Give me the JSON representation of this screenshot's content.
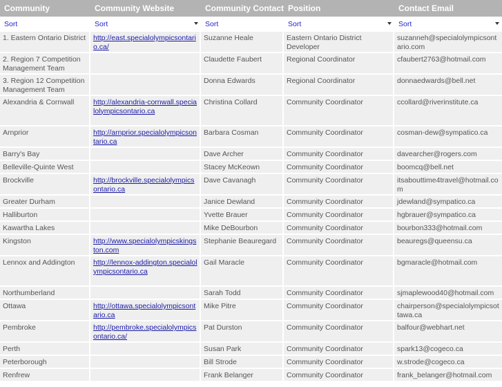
{
  "columns": [
    {
      "label": "Community",
      "sort_label": "Sort",
      "has_dropdown": false
    },
    {
      "label": "Community Website",
      "sort_label": "Sort",
      "has_dropdown": true
    },
    {
      "label": "Community Contact",
      "sort_label": "Sort",
      "has_dropdown": false
    },
    {
      "label": "Position",
      "sort_label": "Sort",
      "has_dropdown": true
    },
    {
      "label": "Contact Email",
      "sort_label": "Sort",
      "has_dropdown": true
    }
  ],
  "rows": [
    {
      "community": "1. Eastern Ontario District",
      "website": "http://east.specialolympicsontario.ca/",
      "contact": "Suzanne Heale",
      "position": "Eastern Ontario District Developer",
      "email": "suzanneh@specialolympicsontario.com"
    },
    {
      "community": "2. Region 7 Competition Management Team",
      "website": "",
      "contact": "Claudette Faubert",
      "position": "Regional Coordinator",
      "email": "cfaubert2763@hotmail.com"
    },
    {
      "community": "3. Region 12 Competition Management Team",
      "website": "",
      "contact": "Donna Edwards",
      "position": "Regional Coordinator",
      "email": "donnaedwards@bell.net"
    },
    {
      "community": "Alexandria & Cornwall",
      "website": "http://alexandria-cornwall.specialolympicsontario.ca",
      "contact": "Christina Collard",
      "position": "Community Coordinator",
      "email": "ccollard@riverinstitute.ca"
    },
    {
      "community": "Arnprior",
      "website": "http://arnprior.specialolympicsontario.ca",
      "contact": "Barbara Cosman",
      "position": "Community Coordinator",
      "email": "cosman-dew@sympatico.ca"
    },
    {
      "community": "Barry's Bay",
      "website": "",
      "contact": "Dave Archer",
      "position": "Community Coordinator",
      "email": "davearcher@rogers.com"
    },
    {
      "community": "Belleville-Quinte West",
      "website": "",
      "contact": "Stacey McKeown",
      "position": "Community Coordinator",
      "email": "boomcq@bell.net"
    },
    {
      "community": "Brockville",
      "website": "http://brockville.specialolympicsontario.ca",
      "contact": "Dave Cavanagh",
      "position": "Community Coordinator",
      "email": "itsabouttime4travel@hotmail.com"
    },
    {
      "community": "Greater Durham",
      "website": "",
      "contact": "Janice Dewland",
      "position": "Community Coordinator",
      "email": "jdewland@sympatico.ca"
    },
    {
      "community": "Halliburton",
      "website": "",
      "contact": "Yvette Brauer",
      "position": "Community Coordinator",
      "email": "hgbrauer@sympatico.ca"
    },
    {
      "community": "Kawartha Lakes",
      "website": "",
      "contact": "Mike DeBourbon",
      "position": "Community Coordinator",
      "email": "bourbon333@hotmail.com"
    },
    {
      "community": "Kingston",
      "website": "http://www.specialolympicskingston.com",
      "contact": "Stephanie Beauregard",
      "position": "Community Coordinator",
      "email": "beauregs@queensu.ca"
    },
    {
      "community": "Lennox and Addington",
      "website": "http://lennox-addington.specialolympicsontario.ca",
      "contact": "Gail Maracle",
      "position": "Community Coordinator",
      "email": "bgmaracle@hotmail.com"
    },
    {
      "community": "Northumberland",
      "website": "",
      "contact": "Sarah Todd",
      "position": "Community Coordinator",
      "email": "sjmaplewood40@hotmail.com"
    },
    {
      "community": "Ottawa",
      "website": "http://ottawa.specialolympicsontario.ca",
      "contact": "Mike Pitre",
      "position": "Community Coordinator",
      "email": "chairperson@specialolympicsottawa.ca"
    },
    {
      "community": "Pembroke",
      "website": "http://pembroke.specialolympicsontario.ca/",
      "contact": "Pat Durston",
      "position": "Community Coordinator",
      "email": "balfour@webhart.net"
    },
    {
      "community": "Perth",
      "website": "",
      "contact": "Susan Park",
      "position": "Community Coordinator",
      "email": "spark13@cogeco.ca"
    },
    {
      "community": "Peterborough",
      "website": "",
      "contact": "Bill Strode",
      "position": "Community Coordinator",
      "email": "w.strode@cogeco.ca"
    },
    {
      "community": "Renfrew",
      "website": "",
      "contact": "Frank Belanger",
      "position": "Community Coordinator",
      "email": "frank_belanger@hotmail.com"
    }
  ]
}
